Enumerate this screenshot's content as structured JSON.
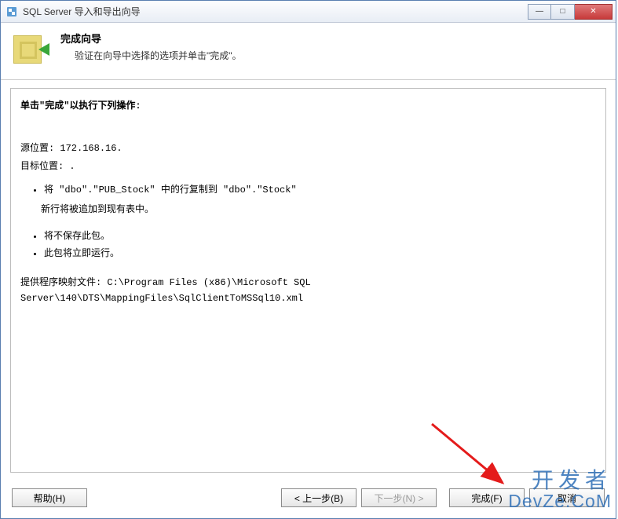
{
  "window": {
    "title": "SQL Server 导入和导出向导",
    "controls": {
      "min": "—",
      "max": "□",
      "close": "✕"
    }
  },
  "header": {
    "title": "完成向导",
    "subtitle": "验证在向导中选择的选项并单击\"完成\"。"
  },
  "content": {
    "heading": "单击\"完成\"以执行下列操作:",
    "source_label": "源位置: ",
    "source_value": "172.168.16.",
    "target_label": "目标位置: ",
    "target_value": ".",
    "copy_action": "将 \"dbo\".\"PUB_Stock\" 中的行复制到 \"dbo\".\"Stock\"",
    "copy_note": "新行将被追加到现有表中。",
    "bullets2": [
      "将不保存此包。",
      "此包将立即运行。"
    ],
    "mapping_label": "提供程序映射文件: ",
    "mapping_value": "C:\\Program Files (x86)\\Microsoft SQL Server\\140\\DTS\\MappingFiles\\SqlClientToMSSql10.xml"
  },
  "buttons": {
    "help": "帮助(H)",
    "back": "< 上一步(B)",
    "next": "下一步(N) >",
    "finish": "完成(F)",
    "cancel": "取消"
  },
  "watermark": {
    "cn": "开发者",
    "en": "DevZe.CoM"
  }
}
